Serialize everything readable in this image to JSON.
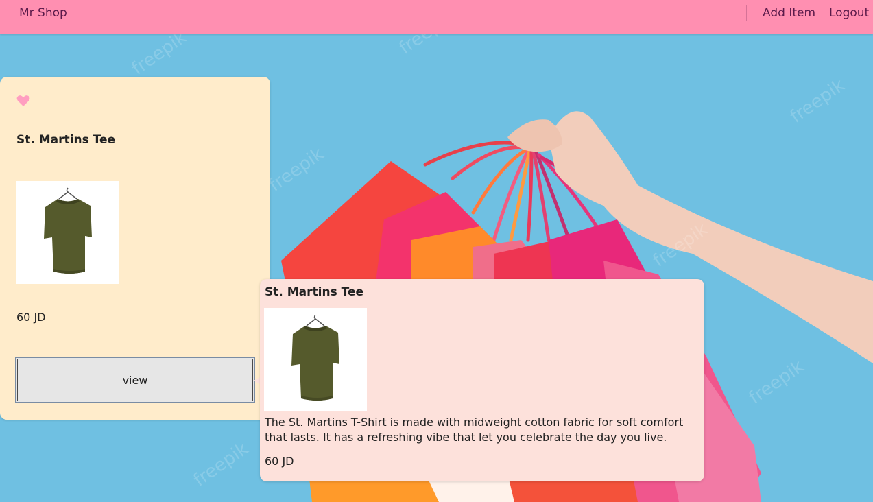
{
  "navbar": {
    "brand": "Mr Shop",
    "add_item": "Add Item",
    "logout": "Logout",
    "background_color": "#ff8fb1"
  },
  "hero": {
    "background_color": "#6fc0e2",
    "watermark": "freepik"
  },
  "card": {
    "favorite_icon": "heart-icon",
    "title": "St. Martins Tee",
    "image": "olive-tshirt-on-hanger",
    "price": "60 JD",
    "view_label": "view",
    "background_color": "#ffeccb"
  },
  "popover": {
    "title": "St. Martins Tee",
    "image": "olive-tshirt-on-hanger",
    "description": "The St. Martins T-Shirt is made with midweight cotton fabric for soft comfort that lasts. It has a refreshing vibe that let you celebrate the day you live.",
    "price": "60 JD",
    "background_color": "#fde1db"
  }
}
